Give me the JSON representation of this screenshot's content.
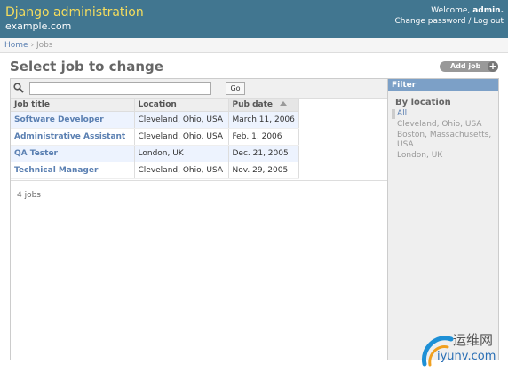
{
  "header": {
    "site_title": "Django administration",
    "site_domain": "example.com",
    "welcome_text": "Welcome,",
    "username": "admin.",
    "change_password": "Change password",
    "separator": "/",
    "logout": "Log out"
  },
  "breadcrumbs": {
    "home": "Home",
    "sep": "›",
    "current": "Jobs"
  },
  "page": {
    "title": "Select job to change",
    "add_button": "Add job",
    "add_icon": "+"
  },
  "search": {
    "value": "",
    "placeholder": "",
    "go_label": "Go",
    "icon": "search-icon"
  },
  "table": {
    "columns": [
      "Job title",
      "Location",
      "Pub date"
    ],
    "sorted_column": "Pub date",
    "rows": [
      {
        "title": "Software Developer",
        "location": "Cleveland, Ohio, USA",
        "date": "March 11, 2006"
      },
      {
        "title": "Administrative Assistant",
        "location": "Cleveland, Ohio, USA",
        "date": "Feb. 1, 2006"
      },
      {
        "title": "QA Tester",
        "location": "London, UK",
        "date": "Dec. 21, 2005"
      },
      {
        "title": "Technical Manager",
        "location": "Cleveland, Ohio, USA",
        "date": "Nov. 29, 2005"
      }
    ],
    "count_text": "4 jobs"
  },
  "filter": {
    "header": "Filter",
    "by_label": "By location",
    "options": [
      {
        "label": "All",
        "selected": true
      },
      {
        "label": "Cleveland, Ohio, USA",
        "selected": false
      },
      {
        "label": "Boston, Massachusetts, USA",
        "selected": false
      },
      {
        "label": "London, UK",
        "selected": false
      }
    ]
  },
  "watermark": {
    "cn": "运维网",
    "en": "iyunv.com"
  },
  "colors": {
    "header_bg": "#417690",
    "title_yellow": "#f5dd5d",
    "link_blue": "#5b80b2",
    "filter_header_bg": "#7ca0c7",
    "row_highlight": "#edf3fe"
  }
}
